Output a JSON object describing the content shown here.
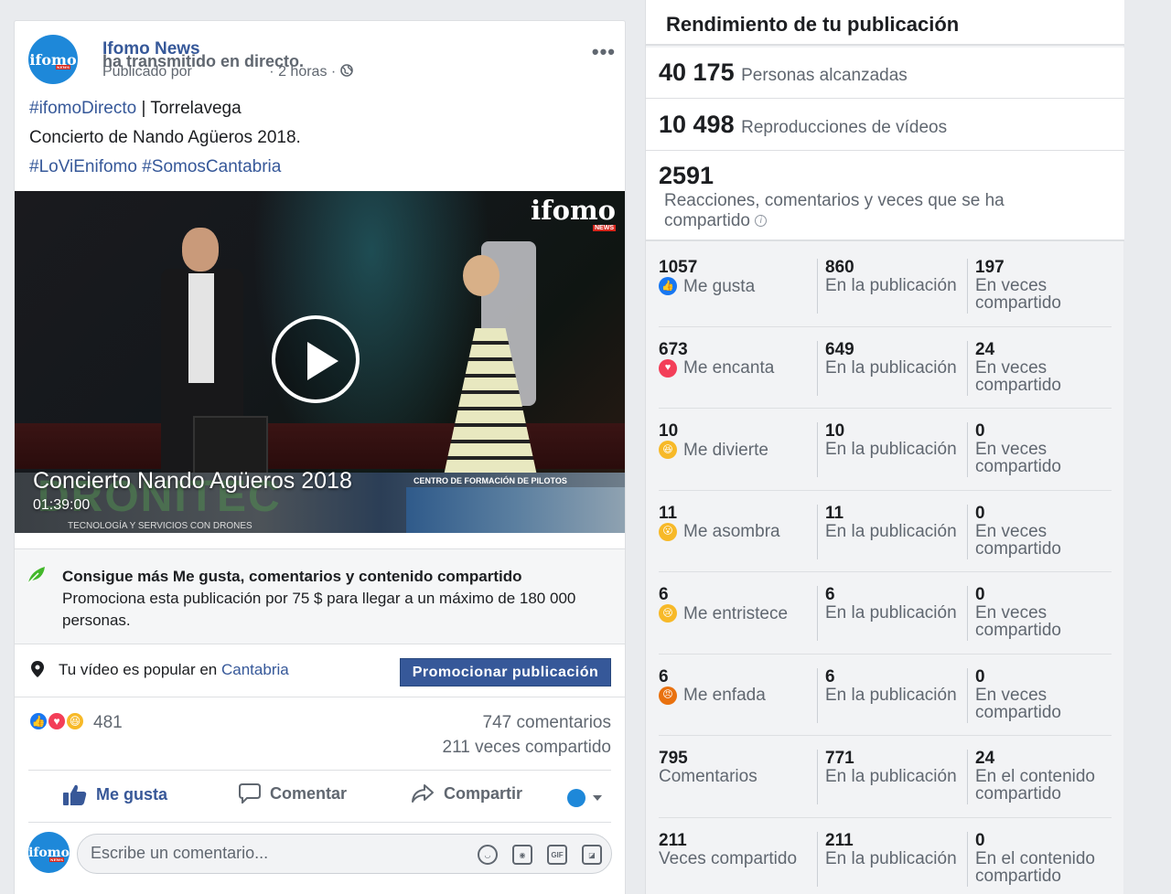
{
  "post": {
    "author": "Ifomo News",
    "action": "ha transmitido en directo.",
    "avatar_text": "ifomo",
    "avatar_badge": "NEWS",
    "published_by": "Publicado por",
    "time": "· 2 horas ·",
    "more_label": "•••",
    "text_line1_tag": "#ifomoDirecto",
    "text_line1_rest": " | Torrelavega",
    "text_line2": "Concierto de Nando Agüeros 2018.",
    "text_line3": "#LoViEnifomo #SomosCantabria"
  },
  "video": {
    "watermark": "ifomo",
    "watermark_badge": "NEWS",
    "title": "Concierto Nando Agüeros 2018",
    "duration": "01:39:00",
    "ad_brand": "DRONITEC",
    "ad_sub": "TECNOLOGÍA Y SERVICIOS CON DRONES",
    "ad_title": "CENTRO DE FORMACIÓN DE PILOTOS"
  },
  "promo": {
    "title": "Consigue más Me gusta, comentarios y contenido compartido",
    "description": "Promociona esta publicación por 75 $ para llegar a un máximo de 180 000 personas."
  },
  "popular": {
    "text": "Tu vídeo es popular en ",
    "location": "Cantabria",
    "button": "Promocionar publicación"
  },
  "reactions": {
    "count": "481",
    "comments": "747 comentarios",
    "shares": "211 veces compartido"
  },
  "actions": {
    "like": "Me gusta",
    "comment": "Comentar",
    "share": "Compartir"
  },
  "comment_box": {
    "placeholder": "Escribe un comentario..."
  },
  "insights": {
    "title": "Rendimiento de tu publicación",
    "reach_num": "40 175",
    "reach_label": "Personas alcanzadas",
    "views_num": "10 498",
    "views_label": "Reproducciones de vídeos",
    "eng_num": "2591",
    "eng_label": "Reacciones, comentarios y veces que se ha compartido",
    "rows": [
      {
        "n1": "1057",
        "l1": "Me gusta",
        "emoji": "like",
        "n2": "860",
        "l2": "En la publicación",
        "n3": "197",
        "l3": "En veces compartido"
      },
      {
        "n1": "673",
        "l1": "Me encanta",
        "emoji": "love",
        "n2": "649",
        "l2": "En la publicación",
        "n3": "24",
        "l3": "En veces compartido"
      },
      {
        "n1": "10",
        "l1": "Me divierte",
        "emoji": "haha",
        "n2": "10",
        "l2": "En la publicación",
        "n3": "0",
        "l3": "En veces compartido"
      },
      {
        "n1": "11",
        "l1": "Me asombra",
        "emoji": "wow",
        "n2": "11",
        "l2": "En la publicación",
        "n3": "0",
        "l3": "En veces compartido"
      },
      {
        "n1": "6",
        "l1": "Me entristece",
        "emoji": "sad",
        "n2": "6",
        "l2": "En la publicación",
        "n3": "0",
        "l3": "En veces compartido"
      },
      {
        "n1": "6",
        "l1": "Me enfada",
        "emoji": "angry",
        "n2": "6",
        "l2": "En la publicación",
        "n3": "0",
        "l3": "En veces compartido"
      },
      {
        "n1": "795",
        "l1": "Comentarios",
        "emoji": "",
        "n2": "771",
        "l2": "En la publicación",
        "n3": "24",
        "l3": "En el contenido compartido"
      },
      {
        "n1": "211",
        "l1": "Veces compartido",
        "emoji": "",
        "n2": "211",
        "l2": "En la publicación",
        "n3": "0",
        "l3": "En el contenido compartido"
      }
    ]
  },
  "colors": {
    "link": "#365899",
    "like_blue": "#1877f2",
    "love_red": "#f33e58",
    "emoji_yellow": "#f7b928",
    "angry_red": "#e9710f"
  }
}
